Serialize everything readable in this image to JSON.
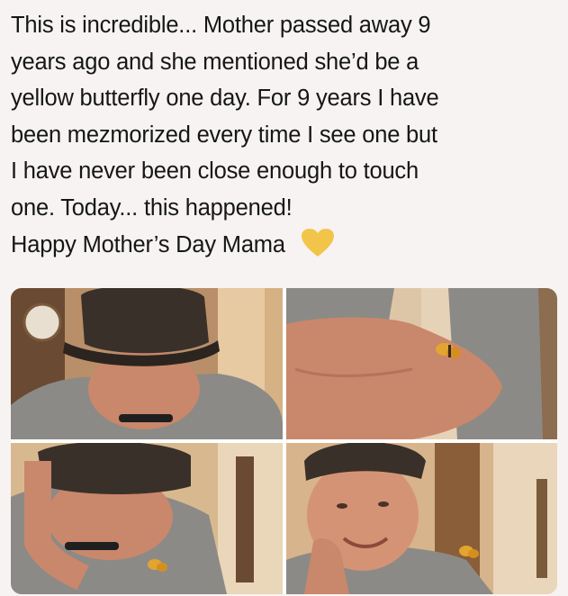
{
  "post": {
    "lines": [
      "This is incredible... Mother passed away 9",
      "years ago and she mentioned she’d be a",
      "yellow butterfly one day. For 9 years I have",
      "been mezmorized every time I see one but",
      "I have never been close enough to touch",
      "one. Today... this happened!",
      "Happy Mother’s Day Mama"
    ],
    "emoji": "yellow-heart-icon",
    "emoji_color": "#f2c54a"
  },
  "photos": [
    {
      "name": "photo-man-covering-face-with-cap"
    },
    {
      "name": "photo-butterfly-on-arm"
    },
    {
      "name": "photo-man-resting-head-on-hand"
    },
    {
      "name": "photo-man-smiling-with-butterfly"
    }
  ],
  "colors": {
    "background": "#f7f3f3",
    "text": "#161616",
    "shirt": "#8c8a87",
    "cap": "#3a302a",
    "skin": "#c9876b",
    "wall": "#e3c49e",
    "butterfly": "#e2a52f"
  }
}
